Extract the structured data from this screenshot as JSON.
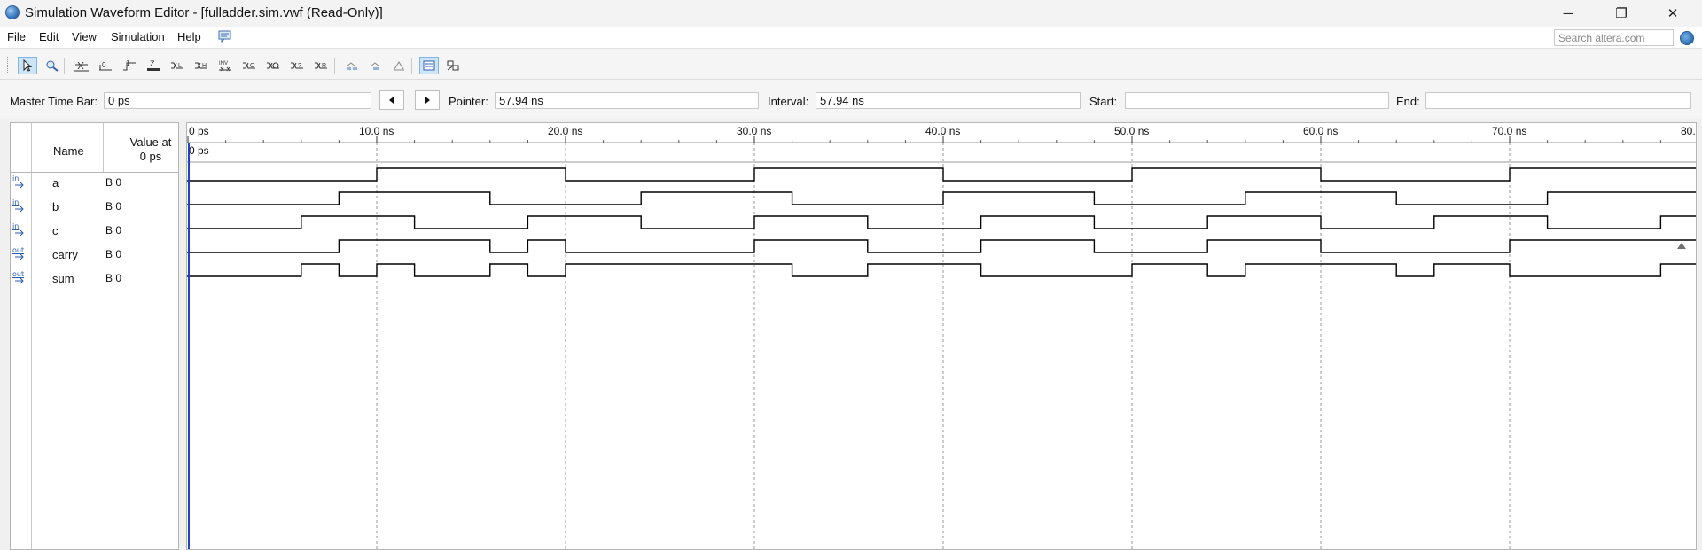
{
  "window": {
    "title": "Simulation Waveform Editor - [fulladder.sim.vwf (Read-Only)]",
    "minimize": "─",
    "restore": "❐",
    "close": "✕"
  },
  "menu": [
    "File",
    "Edit",
    "View",
    "Simulation",
    "Help"
  ],
  "search": {
    "placeholder": "Search altera.com"
  },
  "toolbar": {
    "icons": [
      "select-icon",
      "zoom-icon",
      "force-unknown-icon",
      "force-low-icon",
      "force-high-icon",
      "force-high-impedance-icon",
      "force-weak-low-icon",
      "force-weak-high-icon",
      "invert-icon",
      "count-value-icon",
      "clock-icon",
      "arbitrary-value-icon",
      "random-value-icon",
      "snap-to-grid-icon",
      "arrange-icon",
      "reorder-icon",
      "grid-icon",
      "overwrite-icon"
    ]
  },
  "timebar": {
    "master_label": "Master Time Bar:",
    "master_value": "0 ps",
    "pointer_label": "Pointer:",
    "pointer_value": "57.94 ns",
    "interval_label": "Interval:",
    "interval_value": "57.94 ns",
    "start_label": "Start:",
    "start_value": "",
    "end_label": "End:",
    "end_value": ""
  },
  "table": {
    "name_header": "Name",
    "value_header_line1": "Value at",
    "value_header_line2": "0 ps"
  },
  "signals": [
    {
      "name": "a",
      "direction": "in",
      "value": "B 0",
      "edges": [
        10,
        20,
        30,
        40,
        50,
        60,
        70,
        80
      ]
    },
    {
      "name": "b",
      "direction": "in",
      "value": "B 0",
      "edges": [
        8,
        16,
        24,
        32,
        40,
        48,
        56,
        64,
        72,
        80
      ]
    },
    {
      "name": "c",
      "direction": "in",
      "value": "B 0",
      "edges": [
        6,
        12,
        18,
        24,
        30,
        36,
        42,
        48,
        54,
        60,
        66,
        72,
        78
      ]
    },
    {
      "name": "carry",
      "direction": "out",
      "value": "B 0",
      "edges": [
        8,
        16,
        18,
        20,
        30,
        36,
        42,
        48,
        54,
        60,
        70,
        80
      ]
    },
    {
      "name": "sum",
      "direction": "out",
      "value": "B 0",
      "edges": [
        6,
        8,
        10,
        12,
        16,
        18,
        20,
        32,
        36,
        42,
        50,
        54,
        56,
        64,
        66,
        70,
        78
      ]
    }
  ],
  "timeline": {
    "ticks": [
      "0 ps",
      "10.0 ns",
      "20.0 ns",
      "30.0 ns",
      "40.0 ns",
      "50.0 ns",
      "60.0 ns",
      "70.0 ns",
      "80."
    ],
    "tick_values_ns": [
      0,
      10,
      20,
      30,
      40,
      50,
      60,
      70,
      80
    ],
    "master_marker_label": "0 ps",
    "cursor_ns": 0
  },
  "colors": {
    "cursor": "#1f3fd8",
    "wave": "#000000",
    "grid": "#9a9a9a",
    "in_pin": "#2a5db0"
  }
}
